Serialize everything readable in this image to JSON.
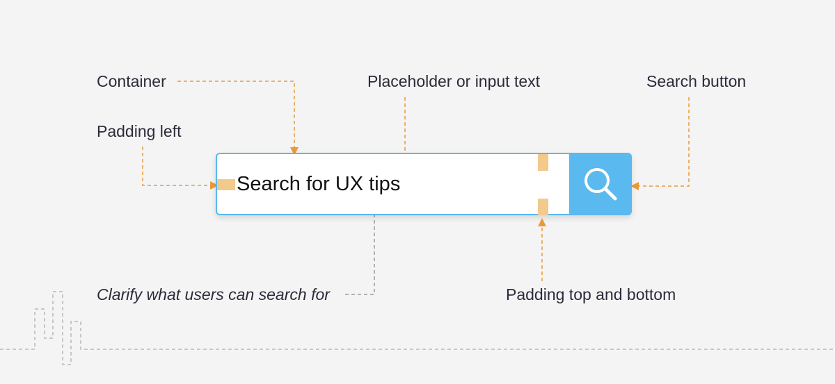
{
  "labels": {
    "container": "Container",
    "placeholder_or_input": "Placeholder or input text",
    "search_button": "Search button",
    "padding_left": "Padding left",
    "clarify": "Clarify what users can search for",
    "padding_top_bottom": "Padding top and bottom"
  },
  "search": {
    "input_text": "Search for UX tips",
    "button_icon": "search-icon"
  },
  "colors": {
    "background": "#f4f4f4",
    "accent_blue": "#5ab9ee",
    "annotation_orange": "#ea9a3a",
    "padding_highlight": "#f3c98c",
    "gray_dashed": "#9a9a9a"
  }
}
